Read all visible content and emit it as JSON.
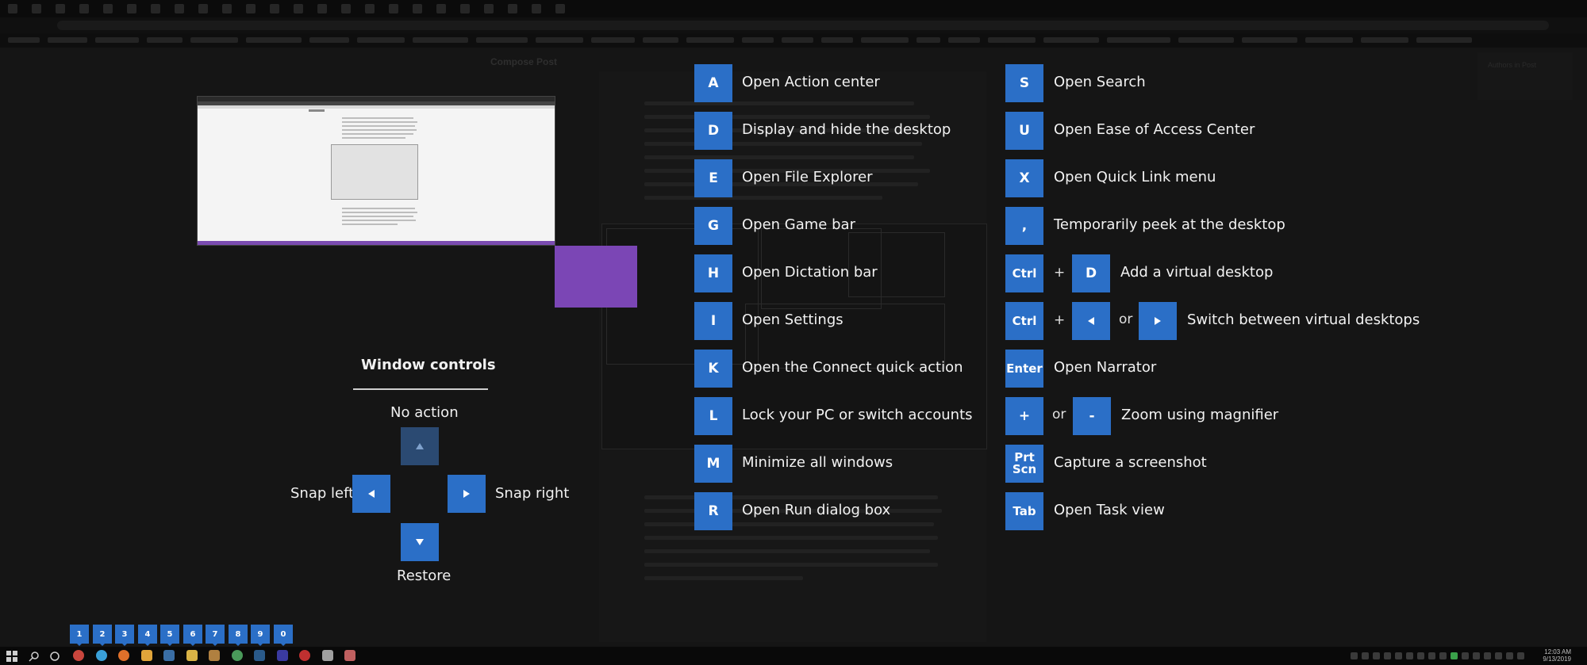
{
  "shortcuts_left": [
    {
      "key": "A",
      "desc": "Open Action center"
    },
    {
      "key": "D",
      "desc": "Display and hide the desktop"
    },
    {
      "key": "E",
      "desc": "Open File Explorer"
    },
    {
      "key": "G",
      "desc": "Open Game bar"
    },
    {
      "key": "H",
      "desc": "Open Dictation bar"
    },
    {
      "key": "I",
      "desc": "Open Settings"
    },
    {
      "key": "K",
      "desc": "Open the Connect quick action"
    },
    {
      "key": "L",
      "desc": "Lock your PC or switch accounts"
    },
    {
      "key": "M",
      "desc": "Minimize all windows"
    },
    {
      "key": "R",
      "desc": "Open Run dialog box"
    }
  ],
  "shortcuts_right": {
    "search": {
      "key": "S",
      "desc": "Open Search"
    },
    "ease": {
      "key": "U",
      "desc": "Open Ease of Access Center"
    },
    "quicklink": {
      "key": "X",
      "desc": "Open Quick Link menu"
    },
    "peek": {
      "key": ",",
      "desc": "Temporarily peek at the desktop"
    },
    "add_desktop": {
      "key1": "Ctrl",
      "plus": "+",
      "key2": "D",
      "desc": "Add a virtual desktop"
    },
    "switch_desktop": {
      "key1": "Ctrl",
      "plus": "+",
      "or": "or",
      "desc": "Switch between virtual desktops"
    },
    "narrator": {
      "key": "Enter",
      "desc": "Open Narrator"
    },
    "magnifier": {
      "key1": "+",
      "or": "or",
      "key2": "-",
      "desc": "Zoom using magnifier"
    },
    "screenshot": {
      "key": "Prt Scn",
      "desc": "Capture a screenshot"
    },
    "taskview": {
      "key": "Tab",
      "desc": "Open Task view"
    }
  },
  "window_controls": {
    "title": "Window controls",
    "no_action": "No action",
    "snap_left": "Snap left",
    "snap_right": "Snap right",
    "restore": "Restore"
  },
  "virtual_desktop_numbers": [
    "1",
    "2",
    "3",
    "4",
    "5",
    "6",
    "7",
    "8",
    "9",
    "0"
  ],
  "background": {
    "compose_title": "Compose Post",
    "authors_label": "Authors in Post"
  },
  "taskbar": {
    "time": "12:03 AM",
    "date": "9/13/2019"
  },
  "colors": {
    "key_blue": "#2b6fc7",
    "snap_purple": "#7b46b5",
    "overlay_bg": "#121212"
  }
}
